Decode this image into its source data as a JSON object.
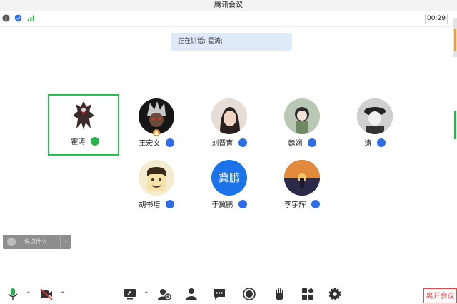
{
  "window": {
    "title": "腾讯会议"
  },
  "infobar": {
    "timer": "00:29",
    "icons": [
      "info-icon",
      "security-shield-icon",
      "signal-icon"
    ]
  },
  "speaking": {
    "text": "正在讲话: 霍涛;"
  },
  "participants": [
    {
      "name": "霍涛",
      "avatar": "armored-character",
      "active_speaker": true,
      "mic_color": "#27b24a"
    },
    {
      "name": "王宏文",
      "avatar": "dark-anime-character",
      "host_badge": true,
      "mic_color": "#2f6de8"
    },
    {
      "name": "刘晋育",
      "avatar": "woman-photo",
      "mic_color": "#2f6de8"
    },
    {
      "name": "魏娴",
      "avatar": "cartoon-girl",
      "mic_color": "#2f6de8"
    },
    {
      "name": "涛",
      "avatar": "bw-portrait",
      "mic_color": "#2f6de8"
    },
    {
      "name": "胡书培",
      "avatar": "cartoon-face",
      "mic_color": "#2f6de8"
    },
    {
      "name": "于冀鹏",
      "avatar": "text-avatar",
      "avatar_text": "冀鹏",
      "avatar_color": "#1a73e8",
      "mic_color": "#2f6de8"
    },
    {
      "name": "李宇辉",
      "avatar": "sunset-photo",
      "mic_color": "#2f6de8"
    }
  ],
  "chat": {
    "placeholder": "说点什么...",
    "collapse": "‹"
  },
  "toolbar": {
    "items": [
      "microphone-icon",
      "camera-off-icon",
      "screen-share-icon",
      "invite-icon",
      "members-icon",
      "chat-icon",
      "record-icon",
      "raise-hand-icon",
      "apps-icon",
      "settings-icon"
    ],
    "leave_label": "离开会议"
  }
}
